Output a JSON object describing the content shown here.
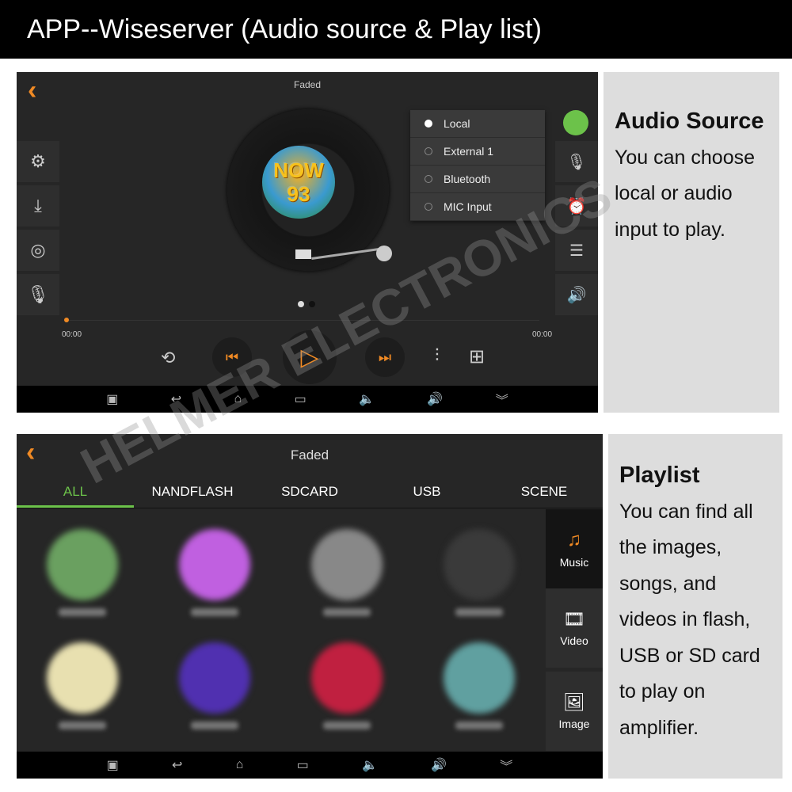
{
  "header": {
    "title": "APP--Wiseserver (Audio source & Play list)"
  },
  "player": {
    "song_title": "Faded",
    "time_current": "00:00",
    "time_total": "00:00",
    "progress": 0,
    "source_menu": [
      {
        "label": "Local",
        "selected": true
      },
      {
        "label": "External 1",
        "selected": false
      },
      {
        "label": "Bluetooth",
        "selected": false
      },
      {
        "label": "MIC Input",
        "selected": false
      }
    ],
    "album_art_text": "NOW 93",
    "accent": "#f08a24",
    "source_icon_color": "#6cc24a"
  },
  "audio_panel": {
    "heading": "Audio Source",
    "body": "You can choose local or audio input to play."
  },
  "playlist": {
    "song_title": "Faded",
    "tabs": [
      "ALL",
      "NANDFLASH",
      "SDCARD",
      "USB",
      "SCENE"
    ],
    "active_tab": "ALL",
    "categories": [
      {
        "label": "Music",
        "active": true
      },
      {
        "label": "Video",
        "active": false
      },
      {
        "label": "Image",
        "active": false
      }
    ],
    "thumb_colors": [
      "#6aa060",
      "#c060e0",
      "#888888",
      "#3a3a3a",
      "#e8e0b0",
      "#5030b0",
      "#c02040",
      "#60a0a0"
    ]
  },
  "playlist_panel": {
    "heading": "Playlist",
    "body": "You can find all the images, songs, and videos in flash, USB or SD card to play on amplifier."
  },
  "watermark": "HELMER ELECTRONICS"
}
